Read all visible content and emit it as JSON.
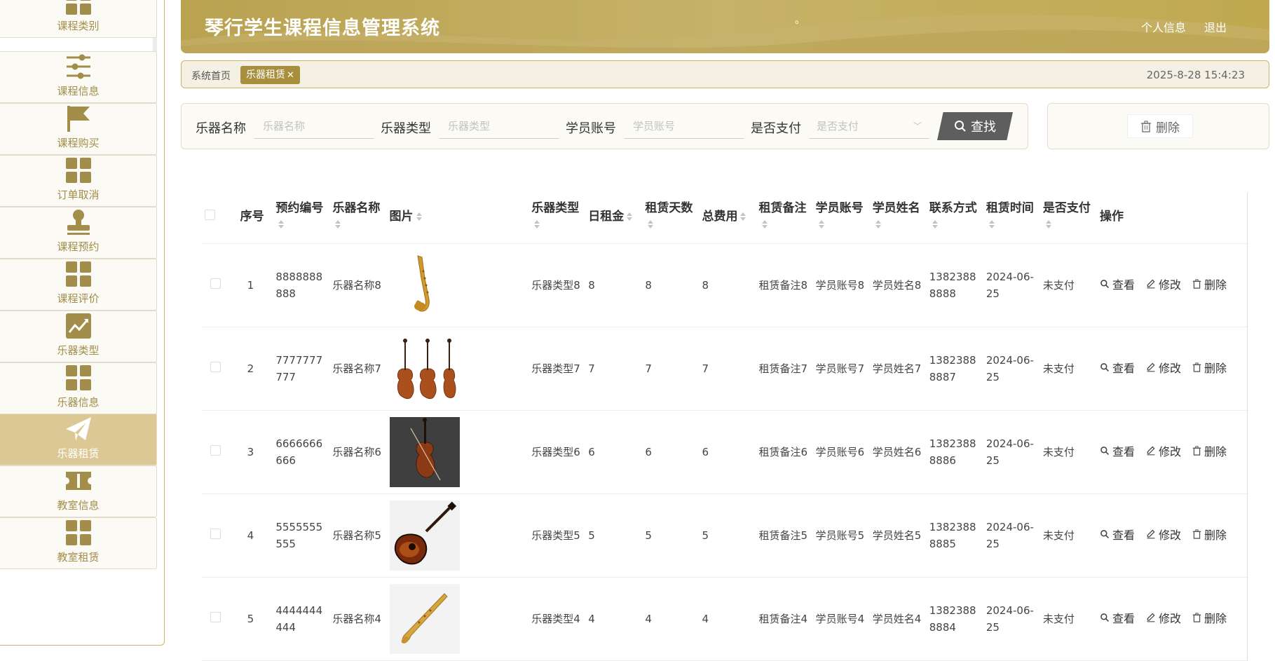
{
  "app_title": "琴行学生课程信息管理系统",
  "header": {
    "dot": "。",
    "profile_label": "个人信息",
    "logout_label": "退出"
  },
  "sidebar": {
    "items": [
      {
        "label": "课程类别",
        "icon": "grid-icon"
      },
      {
        "label": "课程信息",
        "icon": "sliders-icon"
      },
      {
        "label": "课程购买",
        "icon": "flag-icon"
      },
      {
        "label": "订单取消",
        "icon": "grid-icon"
      },
      {
        "label": "课程预约",
        "icon": "stamp-icon"
      },
      {
        "label": "课程评价",
        "icon": "grid-icon"
      },
      {
        "label": "乐器类型",
        "icon": "chart-icon"
      },
      {
        "label": "乐器信息",
        "icon": "grid-icon"
      },
      {
        "label": "乐器租赁",
        "icon": "paper-plane-icon",
        "active": true
      },
      {
        "label": "教室信息",
        "icon": "ticket-icon"
      },
      {
        "label": "教室租赁",
        "icon": "grid-icon"
      }
    ]
  },
  "breadcrumb": {
    "home": "系统首页",
    "current": "乐器租赁",
    "close": "✕",
    "datetime": "2025-8-28 15:4:23"
  },
  "search": {
    "fields": [
      {
        "label": "乐器名称",
        "placeholder": "乐器名称"
      },
      {
        "label": "乐器类型",
        "placeholder": "乐器类型"
      },
      {
        "label": "学员账号",
        "placeholder": "学员账号"
      },
      {
        "label": "是否支付",
        "placeholder": "是否支付"
      }
    ],
    "button_label": "查找"
  },
  "actions": {
    "delete_label": "删除"
  },
  "table": {
    "headers": [
      "序号",
      "预约编号",
      "乐器名称",
      "图片",
      "乐器类型",
      "日租金",
      "租赁天数",
      "总费用",
      "租赁备注",
      "学员账号",
      "学员姓名",
      "联系方式",
      "租赁时间",
      "是否支付",
      "操作"
    ],
    "op_labels": {
      "view": "查看",
      "edit": "修改",
      "delete": "删除"
    },
    "rows": [
      {
        "index": "1",
        "order_no": "8888888888",
        "name": "乐器名称8",
        "image": "saxophone",
        "type": "乐器类型8",
        "daily": "8",
        "days": "8",
        "total": "8",
        "note": "租赁备注8",
        "account": "学员账号8",
        "student": "学员姓名8",
        "phone": "13823888888",
        "date": "2024-06-25",
        "paid": "未支付"
      },
      {
        "index": "2",
        "order_no": "7777777777",
        "name": "乐器名称7",
        "image": "violins",
        "type": "乐器类型7",
        "daily": "7",
        "days": "7",
        "total": "7",
        "note": "租赁备注7",
        "account": "学员账号7",
        "student": "学员姓名7",
        "phone": "13823888887",
        "date": "2024-06-25",
        "paid": "未支付"
      },
      {
        "index": "3",
        "order_no": "6666666666",
        "name": "乐器名称6",
        "image": "violin-dark",
        "type": "乐器类型6",
        "daily": "6",
        "days": "6",
        "total": "6",
        "note": "租赁备注6",
        "account": "学员账号6",
        "student": "学员姓名6",
        "phone": "13823888886",
        "date": "2024-06-25",
        "paid": "未支付"
      },
      {
        "index": "4",
        "order_no": "5555555555",
        "name": "乐器名称5",
        "image": "guitar",
        "type": "乐器类型5",
        "daily": "5",
        "days": "5",
        "total": "5",
        "note": "租赁备注5",
        "account": "学员账号5",
        "student": "学员姓名5",
        "phone": "13823888885",
        "date": "2024-06-25",
        "paid": "未支付"
      },
      {
        "index": "5",
        "order_no": "4444444444",
        "name": "乐器名称4",
        "image": "soprano-sax",
        "type": "乐器类型4",
        "daily": "4",
        "days": "4",
        "total": "4",
        "note": "租赁备注4",
        "account": "学员账号4",
        "student": "学员姓名4",
        "phone": "13823888884",
        "date": "2024-06-25",
        "paid": "未支付"
      }
    ]
  },
  "colors": {
    "accent": "#b9a250",
    "active_nav": "#dcc894",
    "tag": "#a78f3d",
    "search_button": "#5e5e5e"
  }
}
